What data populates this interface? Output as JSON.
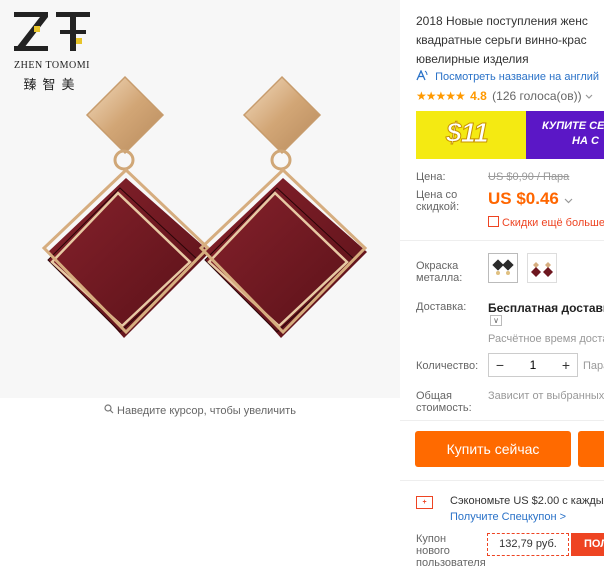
{
  "brand": {
    "logo_icon": "zt-logo-icon",
    "name": "ZHEN TOMOMI",
    "name_cn": "臻智美"
  },
  "gallery": {
    "zoom_hint": "Наведите курсор, чтобы увеличить",
    "zoom_icon": "search-icon"
  },
  "product": {
    "title_lines": [
      "2018 Новые поступления женс",
      "квадратные серьги винно-крас",
      "ювелирные изделия"
    ],
    "translate_link": "Посмотреть название на англий",
    "translate_icon": "translate-icon",
    "stars": "★★★★★",
    "rating": "4.8",
    "votes": "(126 голоса(ов))",
    "votes_dropdown_icon": "chevron-down-icon"
  },
  "banner": {
    "amount": "$11",
    "text_line1": "КУПИТЕ СЕ",
    "text_line2": "НА С"
  },
  "pricing": {
    "price_label": "Цена:",
    "old_price": "US $0,90 / Пара",
    "discount_label": "Цена со скидкой:",
    "price": "US $0.46",
    "price_dropdown_icon": "chevron-down-icon",
    "more_discounts": "Скидки ещё больше",
    "more_discounts_icon": "qr-code-icon"
  },
  "options": {
    "color_label": "Окраска металла:",
    "shipping_label": "Доставка:",
    "shipping_value": "Бесплатная доставка",
    "shipping_dropdown": "∨",
    "delivery_time": "Расчётное время доставки",
    "quantity_label": "Количество:",
    "quantity": "1",
    "minus": "−",
    "plus": "+",
    "unit": "Пара",
    "total_label": "Общая стоимость:",
    "total_value": "Зависит от выбранных"
  },
  "actions": {
    "buy_now": "Купить сейчас"
  },
  "promo": {
    "icon_text": "+",
    "save_text": "Сэкономьте US $2.00 с каждых",
    "coupon_link": "Получите Спецкупон >",
    "newbie_label": "Купон нового пользователя",
    "coupon_value": "132,79 руб.",
    "coupon_button": "ПОЛ"
  },
  "colors": {
    "accent": "#ff6a00",
    "price": "#ff6600",
    "link": "#2a72c8",
    "banner_yellow": "#f4ea12",
    "banner_purple": "#5b17c6",
    "gold": "#d9b48a",
    "leather": "#6e1720"
  }
}
